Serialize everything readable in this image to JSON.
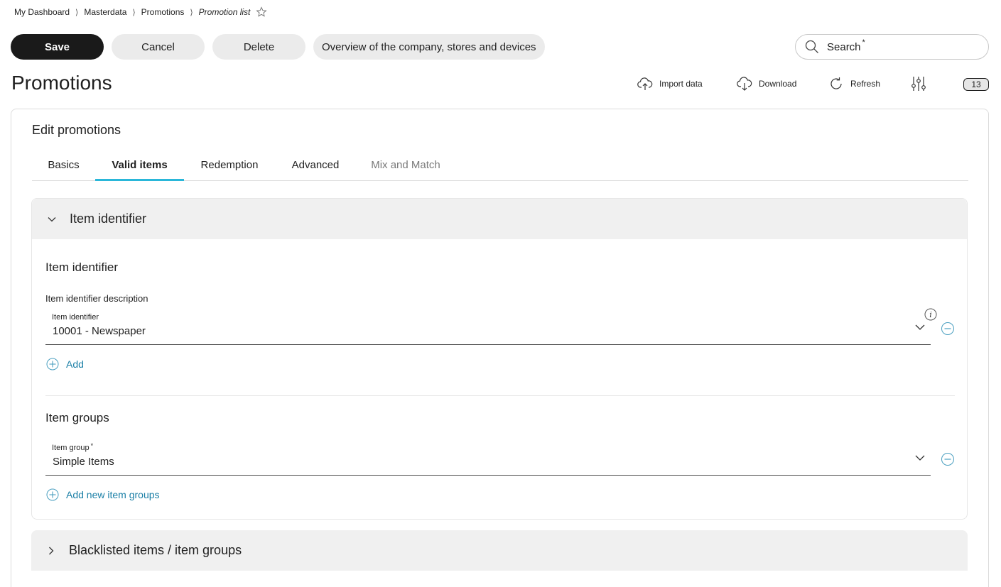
{
  "breadcrumb": {
    "items": [
      "My Dashboard",
      "Masterdata",
      "Promotions"
    ],
    "current": "Promotion list",
    "separator": "⟩"
  },
  "toolbar": {
    "save_label": "Save",
    "cancel_label": "Cancel",
    "delete_label": "Delete",
    "overview_label": "Overview of the company, stores and devices"
  },
  "search": {
    "label": "Search",
    "required_mark": "*"
  },
  "page": {
    "title": "Promotions"
  },
  "actions": {
    "import_label": "Import data",
    "download_label": "Download",
    "refresh_label": "Refresh",
    "count": "13"
  },
  "card": {
    "title": "Edit promotions",
    "tabs": [
      {
        "label": "Basics"
      },
      {
        "label": "Valid items"
      },
      {
        "label": "Redemption"
      },
      {
        "label": "Advanced"
      },
      {
        "label": "Mix and Match"
      }
    ]
  },
  "item_identifier_panel": {
    "header": "Item identifier",
    "section_title": "Item identifier",
    "description": "Item identifier description",
    "field_label": "Item identifier",
    "field_value": "10001 - Newspaper",
    "add_label": "Add"
  },
  "item_groups": {
    "section_title": "Item groups",
    "field_label": "Item group",
    "required_mark": "*",
    "field_value": "Simple Items",
    "add_label": "Add new item groups"
  },
  "blacklist_panel": {
    "header": "Blacklisted items / item groups"
  },
  "colors": {
    "primary_button": "#1a1a1a",
    "tab_underline": "#2ab7d9",
    "link": "#1a7fa6",
    "panel_header_bg": "#f0f0f0"
  }
}
